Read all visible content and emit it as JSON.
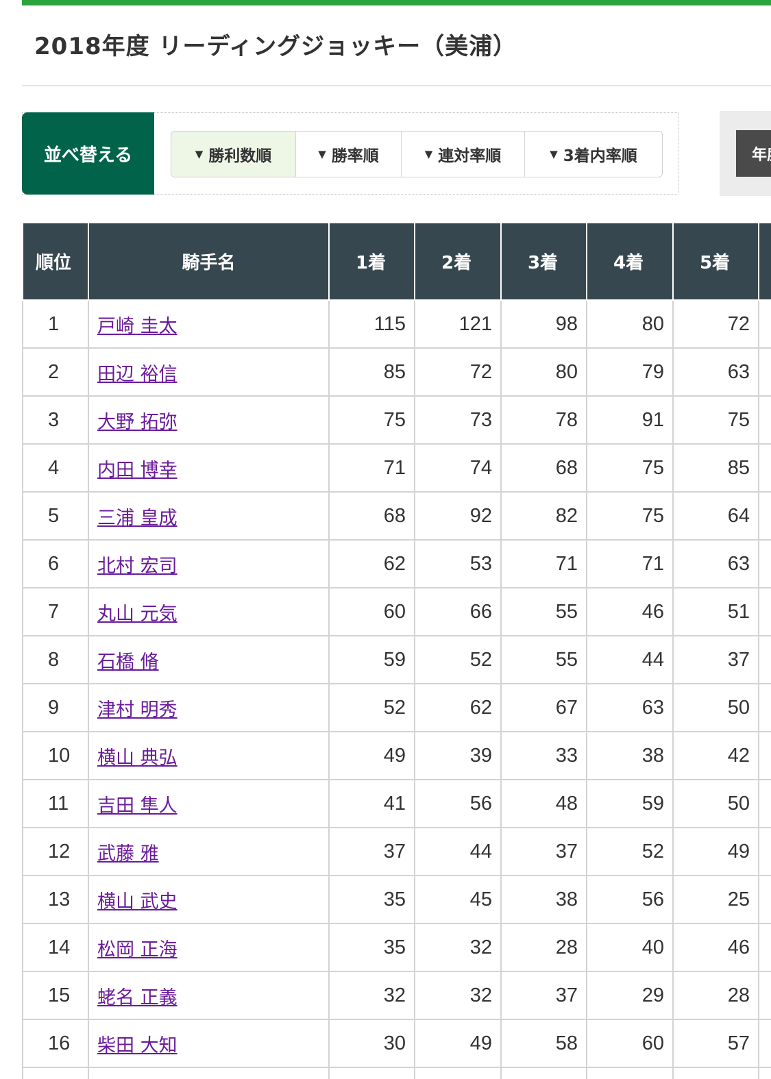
{
  "page": {
    "title": "2018年度 リーディングジョッキー（美浦）"
  },
  "sort": {
    "label": "並べ替える",
    "options": [
      "勝利数順",
      "勝率順",
      "連対率順",
      "3着内率順"
    ],
    "active_index": 0,
    "tri_glyph": "▼"
  },
  "year_button": {
    "label": "年度"
  },
  "table": {
    "headers": [
      "順位",
      "騎手名",
      "1着",
      "2着",
      "3着",
      "4着",
      "5着"
    ],
    "rows": [
      {
        "rank": "1",
        "name": "戸崎 圭太",
        "c1": "115",
        "c2": "121",
        "c3": "98",
        "c4": "80",
        "c5": "72"
      },
      {
        "rank": "2",
        "name": "田辺 裕信",
        "c1": "85",
        "c2": "72",
        "c3": "80",
        "c4": "79",
        "c5": "63"
      },
      {
        "rank": "3",
        "name": "大野 拓弥",
        "c1": "75",
        "c2": "73",
        "c3": "78",
        "c4": "91",
        "c5": "75"
      },
      {
        "rank": "4",
        "name": "内田 博幸",
        "c1": "71",
        "c2": "74",
        "c3": "68",
        "c4": "75",
        "c5": "85"
      },
      {
        "rank": "5",
        "name": "三浦 皇成",
        "c1": "68",
        "c2": "92",
        "c3": "82",
        "c4": "75",
        "c5": "64"
      },
      {
        "rank": "6",
        "name": "北村 宏司",
        "c1": "62",
        "c2": "53",
        "c3": "71",
        "c4": "71",
        "c5": "63"
      },
      {
        "rank": "7",
        "name": "丸山 元気",
        "c1": "60",
        "c2": "66",
        "c3": "55",
        "c4": "46",
        "c5": "51"
      },
      {
        "rank": "8",
        "name": "石橋 脩",
        "c1": "59",
        "c2": "52",
        "c3": "55",
        "c4": "44",
        "c5": "37"
      },
      {
        "rank": "9",
        "name": "津村 明秀",
        "c1": "52",
        "c2": "62",
        "c3": "67",
        "c4": "63",
        "c5": "50"
      },
      {
        "rank": "10",
        "name": "横山 典弘",
        "c1": "49",
        "c2": "39",
        "c3": "33",
        "c4": "38",
        "c5": "42"
      },
      {
        "rank": "11",
        "name": "吉田 隼人",
        "c1": "41",
        "c2": "56",
        "c3": "48",
        "c4": "59",
        "c5": "50"
      },
      {
        "rank": "12",
        "name": "武藤 雅",
        "c1": "37",
        "c2": "44",
        "c3": "37",
        "c4": "52",
        "c5": "49"
      },
      {
        "rank": "13",
        "name": "横山 武史",
        "c1": "35",
        "c2": "45",
        "c3": "38",
        "c4": "56",
        "c5": "25"
      },
      {
        "rank": "14",
        "name": "松岡 正海",
        "c1": "35",
        "c2": "32",
        "c3": "28",
        "c4": "40",
        "c5": "46"
      },
      {
        "rank": "15",
        "name": "蛯名 正義",
        "c1": "32",
        "c2": "32",
        "c3": "37",
        "c4": "29",
        "c5": "28"
      },
      {
        "rank": "16",
        "name": "柴田 大知",
        "c1": "30",
        "c2": "49",
        "c3": "58",
        "c4": "60",
        "c5": "57"
      }
    ]
  },
  "colors": {
    "accent_green": "#2aa43c",
    "sort_label_bg": "#00634a",
    "table_header_bg": "#37474f",
    "link_color": "#6a1b9a"
  }
}
